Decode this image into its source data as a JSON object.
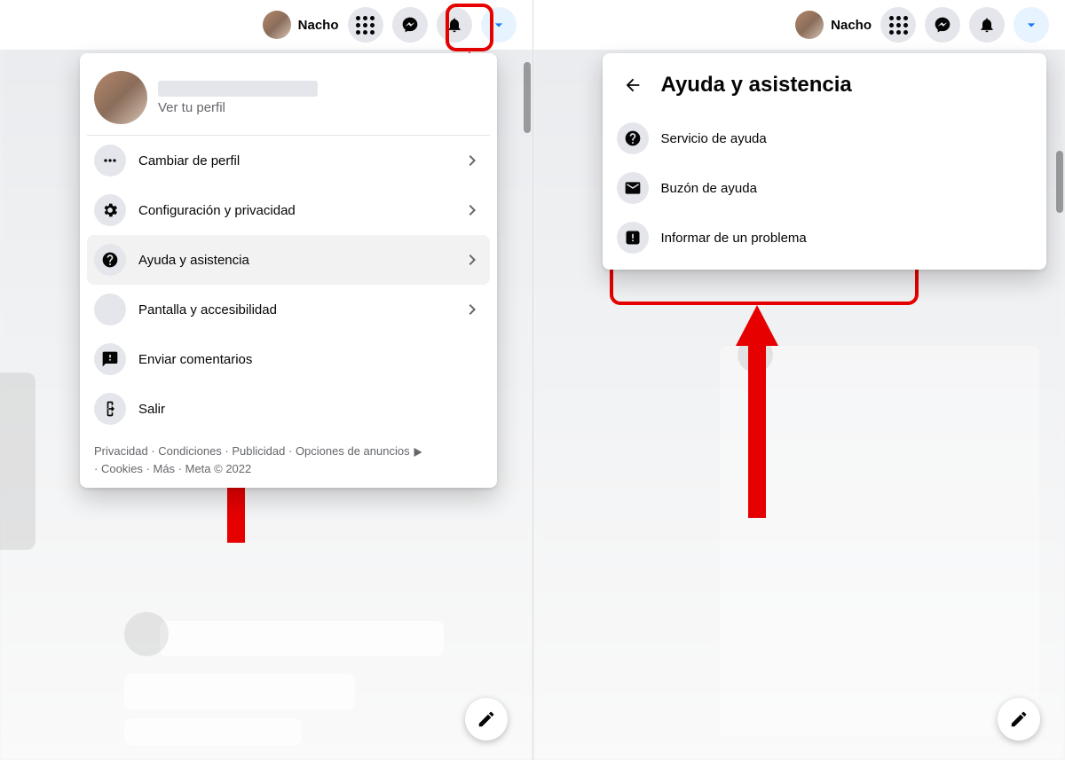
{
  "user": {
    "name": "Nacho"
  },
  "dropdown_left": {
    "profile_sub": "Ver tu perfil",
    "items": [
      {
        "label": "Cambiar de perfil",
        "icon": "dots",
        "chevron": true
      },
      {
        "label": "Configuración y privacidad",
        "icon": "gear",
        "chevron": true
      },
      {
        "label": "Ayuda y asistencia",
        "icon": "help",
        "chevron": true,
        "active": true
      },
      {
        "label": "Pantalla y accesibilidad",
        "icon": "moon",
        "chevron": true
      },
      {
        "label": "Enviar comentarios",
        "icon": "feedback",
        "chevron": false
      },
      {
        "label": "Salir",
        "icon": "logout",
        "chevron": false
      }
    ],
    "footer": {
      "links": [
        "Privacidad",
        "Condiciones",
        "Publicidad",
        "Opciones de anuncios",
        "Cookies",
        "Más"
      ],
      "company": "Meta © 2022"
    }
  },
  "dropdown_right": {
    "title": "Ayuda y asistencia",
    "items": [
      {
        "label": "Servicio de ayuda",
        "icon": "help"
      },
      {
        "label": "Buzón de ayuda",
        "icon": "inbox"
      },
      {
        "label": "Informar de un problema",
        "icon": "report",
        "highlighted": true
      }
    ]
  },
  "icons": {
    "caret": "caret",
    "messenger": "messenger",
    "bell": "bell",
    "grid": "grid"
  }
}
